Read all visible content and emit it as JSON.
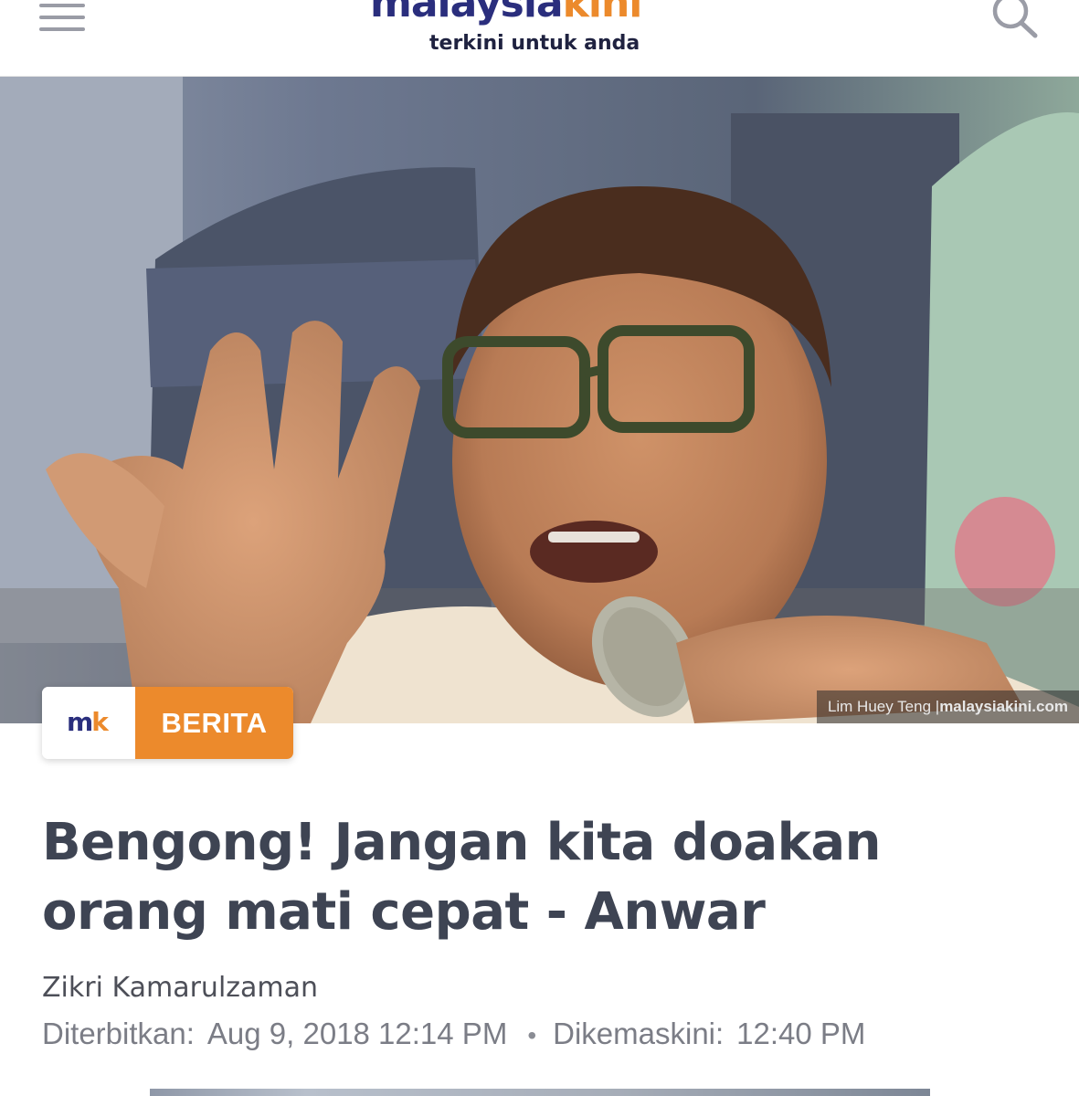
{
  "header": {
    "logo_part1": "malaysia",
    "logo_part2": "kini",
    "tagline": "terkini untuk anda",
    "menu_icon": "hamburger-menu-icon",
    "search_icon": "search-icon"
  },
  "hero": {
    "credit_name": "Lim Huey Teng",
    "credit_separator": "|",
    "credit_site": "malaysiakini.com"
  },
  "badge": {
    "logo_m": "m",
    "logo_k": "k",
    "category": "BERITA"
  },
  "article": {
    "headline": "Bengong! Jangan kita doakan orang mati cepat - Anwar",
    "author": "Zikri Kamarulzaman",
    "published_label": "Diterbitkan:",
    "published_value": "Aug 9, 2018 12:14 PM",
    "separator": "•",
    "updated_label": "Dikemaskini:",
    "updated_value": "12:40 PM"
  },
  "colors": {
    "brand_navy": "#2a2e7d",
    "brand_orange": "#ec8a2c",
    "headline_text": "#3e4453",
    "meta_text": "#7b7d86"
  }
}
